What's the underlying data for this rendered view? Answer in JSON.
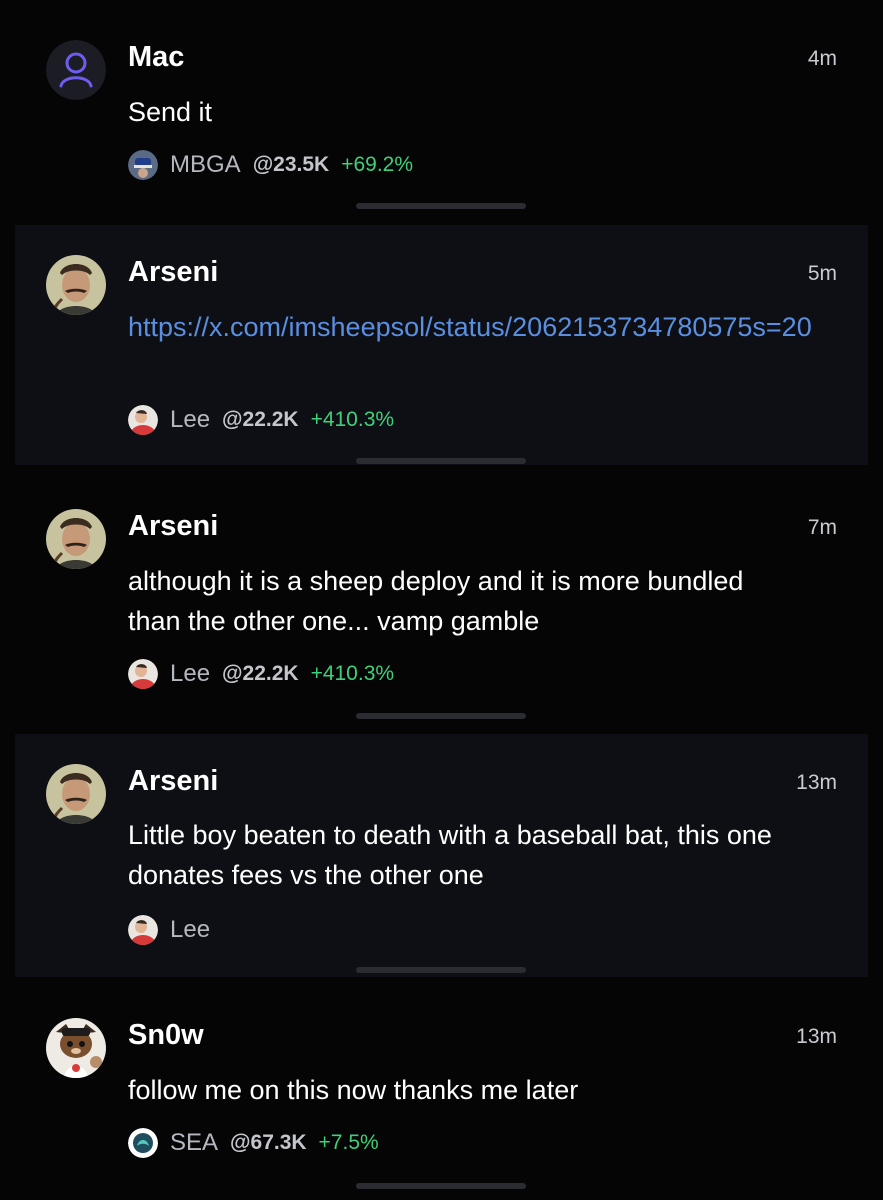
{
  "messages": [
    {
      "author": "Mac",
      "time": "4m",
      "text": "Send it",
      "is_link": false,
      "avatar_icon": "default-user-icon",
      "token": {
        "name": "MBGA",
        "mcap": "@23.5K",
        "change": "+69.2%",
        "icon": "mbga-token-icon"
      }
    },
    {
      "author": "Arseni",
      "time": "5m",
      "text": "https://x.com/imsheepsol/status/2062153734780575s=20",
      "is_link": true,
      "avatar_icon": "mustache-man-avatar-icon",
      "token": {
        "name": "Lee",
        "mcap": "@22.2K",
        "change": "+410.3%",
        "icon": "lee-token-icon"
      }
    },
    {
      "author": "Arseni",
      "time": "7m",
      "text_lines": [
        "although it is a sheep deploy and it is more bundled",
        "than the other one... vamp gamble"
      ],
      "is_link": false,
      "avatar_icon": "mustache-man-avatar-icon",
      "token": {
        "name": "Lee",
        "mcap": "@22.2K",
        "change": "+410.3%",
        "icon": "lee-token-icon"
      }
    },
    {
      "author": "Arseni",
      "time": "13m",
      "text_lines": [
        "Little boy beaten to death with a baseball bat, this one",
        "donates fees vs the other one"
      ],
      "is_link": false,
      "avatar_icon": "mustache-man-avatar-icon",
      "token": {
        "name": "Lee",
        "icon": "lee-token-icon"
      }
    },
    {
      "author": "Sn0w",
      "time": "13m",
      "text": "follow me on this now thanks me later",
      "is_link": false,
      "avatar_icon": "cartoon-dog-avatar-icon",
      "token": {
        "name": "SEA",
        "mcap": "@67.3K",
        "change": "+7.5%",
        "icon": "sea-token-icon"
      }
    }
  ],
  "colors": {
    "background": "#050506",
    "alt_row": "#0d0f14",
    "link": "#5a8fe0",
    "positive": "#3fd07a",
    "muted": "#b5b8bf"
  }
}
